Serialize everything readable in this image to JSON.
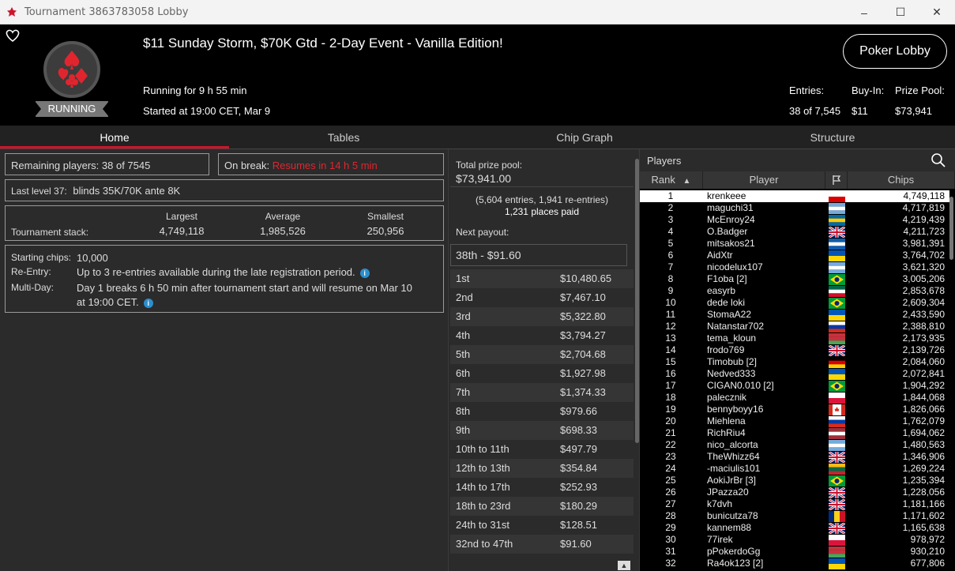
{
  "window": {
    "title": "Tournament 3863783058 Lobby",
    "controls": {
      "minimize": "–",
      "maximize": "☐",
      "close": "✕"
    }
  },
  "header": {
    "tournament_name": "$11 Sunday Storm, $70K Gtd - 2-Day Event - Vanilla Edition!",
    "status": "RUNNING",
    "running_for": "Running for 9 h 55 min",
    "started_at": "Started at 19:00 CET, Mar 9",
    "lobby_button": "Poker Lobby",
    "entries_label": "Entries:",
    "entries_value": "38 of 7,545",
    "buyin_label": "Buy-In:",
    "buyin_value": "$11",
    "prize_label": "Prize Pool:",
    "prize_value": "$73,941"
  },
  "tabs": [
    "Home",
    "Tables",
    "Chip Graph",
    "Structure"
  ],
  "home": {
    "remaining_players": "Remaining players: 38 of 7545",
    "on_break_label": "On break:",
    "on_break_value": "Resumes in 14 h 5 min",
    "last_level_label": "Last level 37:",
    "last_level_value": "blinds 35K/70K ante 8K",
    "stack_label": "Tournament stack:",
    "largest_label": "Largest",
    "largest_value": "4,749,118",
    "average_label": "Average",
    "average_value": "1,985,526",
    "smallest_label": "Smallest",
    "smallest_value": "250,956",
    "starting_chips_label": "Starting chips:",
    "starting_chips_value": "10,000",
    "reentry_label": "Re-Entry:",
    "reentry_value": "Up to 3 re-entries available during the late registration period.",
    "multiday_label": "Multi-Day:",
    "multiday_value_1": "Day 1 breaks 6 h 50 min after tournament start and will resume on Mar 10",
    "multiday_value_2": "at 19:00 CET."
  },
  "prizes": {
    "total_label": "Total prize pool:",
    "total_value": "$73,941.00",
    "entries_note": "(5,604 entries, 1,941 re-entries)",
    "places_paid": "1,231 places paid",
    "next_payout_label": "Next payout:",
    "next_payout_value": "38th - $91.60",
    "rows": [
      {
        "place": "1st",
        "amount": "$10,480.65"
      },
      {
        "place": "2nd",
        "amount": "$7,467.10"
      },
      {
        "place": "3rd",
        "amount": "$5,322.80"
      },
      {
        "place": "4th",
        "amount": "$3,794.27"
      },
      {
        "place": "5th",
        "amount": "$2,704.68"
      },
      {
        "place": "6th",
        "amount": "$1,927.98"
      },
      {
        "place": "7th",
        "amount": "$1,374.33"
      },
      {
        "place": "8th",
        "amount": "$979.66"
      },
      {
        "place": "9th",
        "amount": "$698.33"
      },
      {
        "place": "10th to 11th",
        "amount": "$497.79"
      },
      {
        "place": "12th to 13th",
        "amount": "$354.84"
      },
      {
        "place": "14th to 17th",
        "amount": "$252.93"
      },
      {
        "place": "18th to 23rd",
        "amount": "$180.29"
      },
      {
        "place": "24th to 31st",
        "amount": "$128.51"
      },
      {
        "place": "32nd to 47th",
        "amount": "$91.60"
      }
    ]
  },
  "players": {
    "title": "Players",
    "columns": {
      "rank": "Rank",
      "player": "Player",
      "chips": "Chips"
    },
    "rows": [
      {
        "rank": "1",
        "name": "krenkeee",
        "chips": "4,749,118",
        "flag": [
          "#fff",
          "#d00"
        ]
      },
      {
        "rank": "2",
        "name": "maguchi31",
        "chips": "4,717,819",
        "flag": [
          "#75aadb",
          "#fff",
          "#75aadb"
        ]
      },
      {
        "rank": "3",
        "name": "McEnroy24",
        "chips": "4,219,439",
        "flag": [
          "#006aa7",
          "#fecc00",
          "#006aa7"
        ]
      },
      {
        "rank": "4",
        "name": "O.Badger",
        "chips": "4,211,723",
        "flag": "uk"
      },
      {
        "rank": "5",
        "name": "mitsakos21",
        "chips": "3,981,391",
        "flag": [
          "#0d5eaf",
          "#fff",
          "#0d5eaf"
        ]
      },
      {
        "rank": "6",
        "name": "AidXtr",
        "chips": "3,764,702",
        "flag": [
          "#0057b7",
          "#ffd700"
        ]
      },
      {
        "rank": "7",
        "name": "nicodelux107",
        "chips": "3,621,320",
        "flag": [
          "#75aadb",
          "#fff",
          "#75aadb"
        ]
      },
      {
        "rank": "8",
        "name": "F1oba [2]",
        "chips": "3,005,206",
        "flag": "br"
      },
      {
        "rank": "9",
        "name": "easyrb",
        "chips": "2,853,678",
        "flag": [
          "#006847",
          "#fff",
          "#ce1126"
        ]
      },
      {
        "rank": "10",
        "name": "dede loki",
        "chips": "2,609,304",
        "flag": "br"
      },
      {
        "rank": "11",
        "name": "StomaA22",
        "chips": "2,433,590",
        "flag": [
          "#0057b7",
          "#ffd700"
        ]
      },
      {
        "rank": "12",
        "name": "Natanstar702",
        "chips": "2,388,810",
        "flag": [
          "#fff",
          "#0039a6",
          "#d52b1e"
        ]
      },
      {
        "rank": "13",
        "name": "tema_kloun",
        "chips": "2,173,935",
        "flag": [
          "#c8313e",
          "#c8313e",
          "#4aa657"
        ]
      },
      {
        "rank": "14",
        "name": "frodo769",
        "chips": "2,139,726",
        "flag": "uk"
      },
      {
        "rank": "15",
        "name": "Timobub [2]",
        "chips": "2,084,060",
        "flag": [
          "#000",
          "#d00",
          "#ffce00"
        ]
      },
      {
        "rank": "16",
        "name": "Nedved333",
        "chips": "2,072,841",
        "flag": [
          "#0057b7",
          "#ffd700"
        ]
      },
      {
        "rank": "17",
        "name": "CIGAN0.010 [2]",
        "chips": "1,904,292",
        "flag": "br"
      },
      {
        "rank": "18",
        "name": "palecznik",
        "chips": "1,844,068",
        "flag": [
          "#fff",
          "#dc143c"
        ]
      },
      {
        "rank": "19",
        "name": "bennyboyy16",
        "chips": "1,826,066",
        "flag": "ca"
      },
      {
        "rank": "20",
        "name": "Miehlena",
        "chips": "1,762,079",
        "flag": [
          "#fff",
          "#0039a6",
          "#d52b1e"
        ]
      },
      {
        "rank": "21",
        "name": "RichRiu4",
        "chips": "1,694,062",
        "flag": [
          "#9e3039",
          "#fff",
          "#9e3039"
        ]
      },
      {
        "rank": "22",
        "name": "nico_alcorta",
        "chips": "1,480,563",
        "flag": [
          "#75aadb",
          "#fff",
          "#75aadb"
        ]
      },
      {
        "rank": "23",
        "name": "TheWhizz64",
        "chips": "1,346,906",
        "flag": "uk"
      },
      {
        "rank": "24",
        "name": "-maciulis101",
        "chips": "1,269,224",
        "flag": [
          "#fdb913",
          "#006a44",
          "#c1272d"
        ]
      },
      {
        "rank": "25",
        "name": "AokiJrBr [3]",
        "chips": "1,235,394",
        "flag": "br"
      },
      {
        "rank": "26",
        "name": "JPazza20",
        "chips": "1,228,056",
        "flag": "uk"
      },
      {
        "rank": "27",
        "name": "k7dvh",
        "chips": "1,181,166",
        "flag": "uk"
      },
      {
        "rank": "28",
        "name": "bunicutza78",
        "chips": "1,171,602",
        "flag": "ro"
      },
      {
        "rank": "29",
        "name": "kannem88",
        "chips": "1,165,638",
        "flag": "uk"
      },
      {
        "rank": "30",
        "name": "77irek",
        "chips": "978,972",
        "flag": [
          "#fff",
          "#dc143c"
        ]
      },
      {
        "rank": "31",
        "name": "pPokerdoGg",
        "chips": "930,210",
        "flag": [
          "#c8313e",
          "#c8313e",
          "#4aa657"
        ]
      },
      {
        "rank": "32",
        "name": "Ra4ok123 [2]",
        "chips": "677,806",
        "flag": [
          "#0057b7",
          "#ffd700"
        ]
      }
    ]
  }
}
